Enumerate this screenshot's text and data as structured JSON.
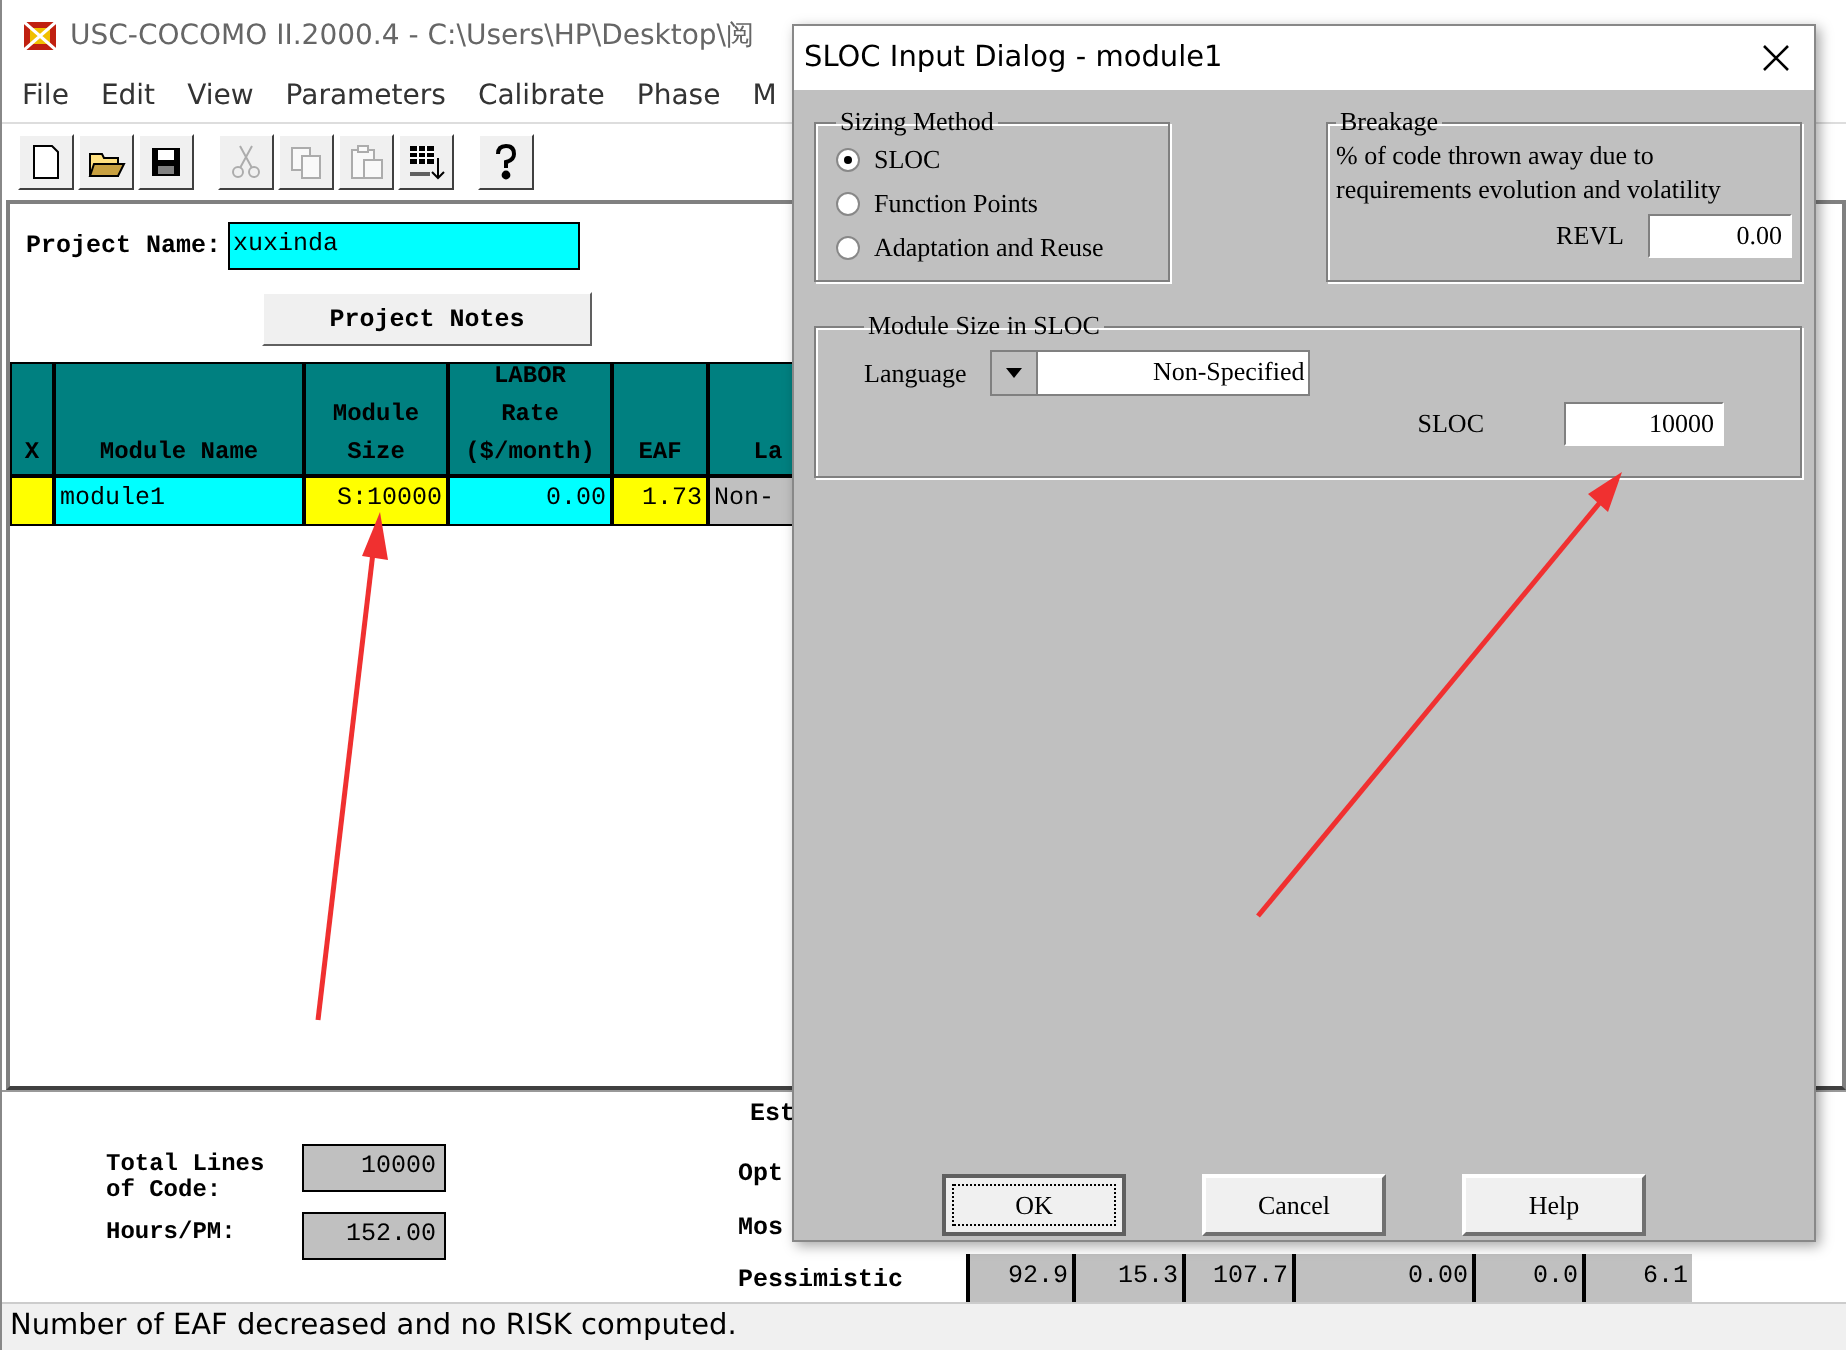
{
  "window": {
    "title": "USC-COCOMO II.2000.4 - C:\\Users\\HP\\Desktop\\阅"
  },
  "menu": [
    "File",
    "Edit",
    "View",
    "Parameters",
    "Calibrate",
    "Phase",
    "M"
  ],
  "toolbar": [
    {
      "kind": "new",
      "disabled": false
    },
    {
      "kind": "open",
      "disabled": false
    },
    {
      "kind": "save",
      "disabled": false
    },
    {
      "kind": "cut",
      "disabled": true
    },
    {
      "kind": "copy",
      "disabled": true
    },
    {
      "kind": "paste",
      "disabled": true
    },
    {
      "kind": "grid",
      "disabled": false
    },
    {
      "kind": "help",
      "disabled": false
    }
  ],
  "project": {
    "label": "Project Name:",
    "value": "xuxinda",
    "notes_button": "Project Notes"
  },
  "table": {
    "columns": [
      "X",
      "Module Name",
      "Module\nSize",
      "LABOR\nRate\n($/month)",
      "EAF",
      "La"
    ],
    "rows": [
      [
        "",
        "module1",
        "S:10000",
        "0.00",
        "1.73",
        "Non-"
      ]
    ]
  },
  "totals": [
    {
      "label": "Total Lines\nof Code:",
      "value": "10000"
    },
    {
      "label": "Hours/PM:",
      "value": "152.00"
    }
  ],
  "estimates": {
    "heading": "Est",
    "labels": [
      "Opt",
      "Mos",
      "Pessimistic"
    ],
    "pessimistic_values": [
      "92.9",
      "15.3",
      "107.7",
      "0.00",
      "0.0",
      "6.1"
    ]
  },
  "status_bar": "Number of EAF decreased and no RISK computed.",
  "dialog": {
    "title": "SLOC Input Dialog - module1",
    "sizing": {
      "title": "Sizing Method",
      "options": [
        {
          "label": "SLOC",
          "selected": true
        },
        {
          "label": "Function Points",
          "selected": false
        },
        {
          "label": "Adaptation and Reuse",
          "selected": false
        }
      ]
    },
    "breakage": {
      "title": "Breakage",
      "description": "% of code thrown away due to requirements evolution and volatility",
      "field_label": "REVL",
      "field_value": "0.00"
    },
    "module_size": {
      "title": "Module Size in SLOC",
      "language_label": "Language",
      "language_value": "Non-Specified",
      "sloc_label": "SLOC",
      "sloc_value": "10000"
    },
    "buttons": [
      "OK",
      "Cancel",
      "Help"
    ]
  }
}
